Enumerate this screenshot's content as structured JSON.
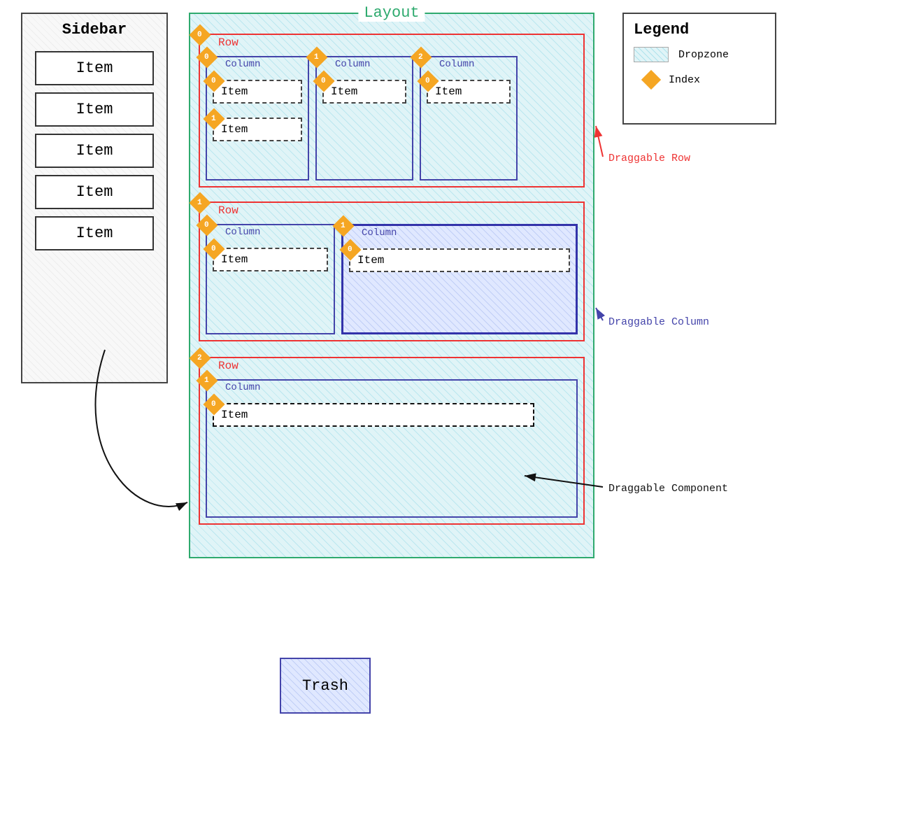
{
  "sidebar": {
    "title": "Sidebar",
    "items": [
      {
        "label": "Item"
      },
      {
        "label": "Item"
      },
      {
        "label": "Item"
      },
      {
        "label": "Item"
      },
      {
        "label": "Item"
      }
    ]
  },
  "layout": {
    "title": "Layout",
    "rows": [
      {
        "index": "0",
        "label": "Row",
        "cols": [
          {
            "index": "0",
            "label": "Column",
            "items": [
              {
                "index": "0",
                "label": "Item"
              },
              {
                "index": "1",
                "label": "Item"
              }
            ]
          },
          {
            "index": "1",
            "label": "Column",
            "items": [
              {
                "index": "0",
                "label": "Item"
              }
            ]
          },
          {
            "index": "2",
            "label": "Column",
            "items": [
              {
                "index": "0",
                "label": "Item"
              }
            ]
          }
        ]
      },
      {
        "index": "1",
        "label": "Row",
        "cols": [
          {
            "index": "0",
            "label": "Column",
            "items": [
              {
                "index": "0",
                "label": "Item"
              }
            ]
          },
          {
            "index": "1",
            "label": "Column",
            "items": [
              {
                "index": "0",
                "label": "Item"
              }
            ]
          }
        ]
      },
      {
        "index": "2",
        "label": "Row",
        "cols": [
          {
            "index": "1",
            "label": "Column",
            "items": [
              {
                "index": "0",
                "label": "Item"
              }
            ]
          }
        ]
      }
    ]
  },
  "legend": {
    "title": "Legend",
    "dropzone_label": "Dropzone",
    "index_label": "Index"
  },
  "annotations": {
    "draggable_row": "Draggable Row",
    "draggable_column": "Draggable Column",
    "draggable_component": "Draggable Component"
  },
  "trash": {
    "label": "Trash"
  }
}
